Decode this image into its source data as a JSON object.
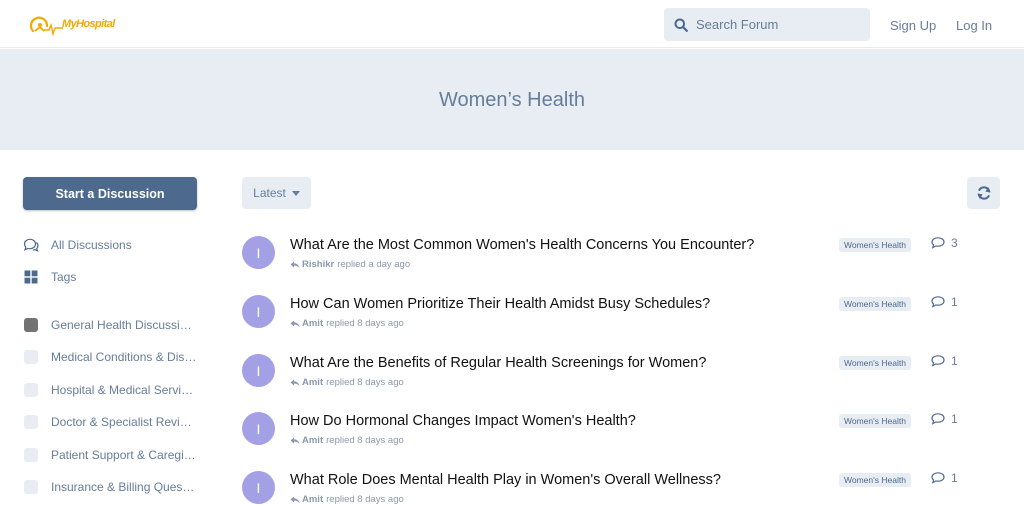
{
  "header": {
    "logo_text": "MyHospital",
    "search_placeholder": "Search Forum",
    "signup_label": "Sign Up",
    "login_label": "Log In"
  },
  "hero": {
    "title": "Women’s Health"
  },
  "sidebar": {
    "start_label": "Start a Discussion",
    "nav": [
      {
        "label": "All Discussions",
        "icon": "comments-icon"
      },
      {
        "label": "Tags",
        "icon": "tags-grid-icon"
      }
    ],
    "categories": [
      {
        "label": "General Health Discussions",
        "color": "#737373"
      },
      {
        "label": "Medical Conditions & Diseases",
        "color": "#e7edf3"
      },
      {
        "label": "Hospital & Medical Services",
        "color": "#e7edf3"
      },
      {
        "label": "Doctor & Specialist Reviews",
        "color": "#e7edf3"
      },
      {
        "label": "Patient Support & Caregiving",
        "color": "#e7edf3"
      },
      {
        "label": "Insurance & Billing Questions",
        "color": "#e7edf3"
      }
    ]
  },
  "toolbar": {
    "sort_label": "Latest"
  },
  "discussions": [
    {
      "avatar": "I",
      "title": "What Are the Most Common Women's Health Concerns You Encounter?",
      "user": "Rishikr",
      "action": "replied",
      "time": "a day ago",
      "tag": "Women's Health",
      "replies": "3"
    },
    {
      "avatar": "I",
      "title": "How Can Women Prioritize Their Health Amidst Busy Schedules?",
      "user": "Amit",
      "action": "replied",
      "time": "8 days ago",
      "tag": "Women's Health",
      "replies": "1"
    },
    {
      "avatar": "I",
      "title": "What Are the Benefits of Regular Health Screenings for Women?",
      "user": "Amit",
      "action": "replied",
      "time": "8 days ago",
      "tag": "Women's Health",
      "replies": "1"
    },
    {
      "avatar": "I",
      "title": "How Do Hormonal Changes Impact Women's Health?",
      "user": "Amit",
      "action": "replied",
      "time": "8 days ago",
      "tag": "Women's Health",
      "replies": "1"
    },
    {
      "avatar": "I",
      "title": "What Role Does Mental Health Play in Women's Overall Wellness?",
      "user": "Amit",
      "action": "replied",
      "time": "8 days ago",
      "tag": "Women's Health",
      "replies": "1"
    }
  ],
  "colors": {
    "primary": "#4d698e",
    "muted": "#667d99",
    "light_bg": "#e7edf3",
    "avatar": "#a4a0e6",
    "logo": "#f2a900"
  }
}
